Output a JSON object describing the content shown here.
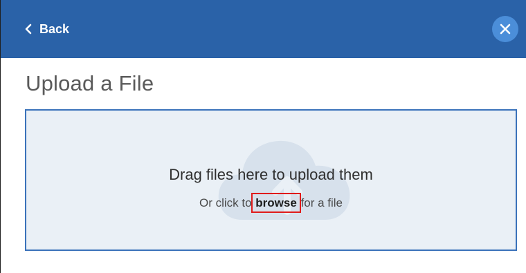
{
  "header": {
    "back_label": "Back",
    "back_icon": "chevron-left-icon",
    "close_icon": "close-icon",
    "bar_color": "#2a62a8",
    "close_bg_color": "#4b8ed9"
  },
  "page": {
    "title": "Upload a File"
  },
  "dropzone": {
    "icon": "cloud-upload-icon",
    "primary_text": "Drag files here to upload them",
    "secondary_prefix": "Or click to",
    "browse_label": "browse",
    "secondary_suffix": "for a file",
    "border_color": "#3a72ba",
    "background_color": "#eaf0f6",
    "highlight_color": "#e01b1b"
  }
}
